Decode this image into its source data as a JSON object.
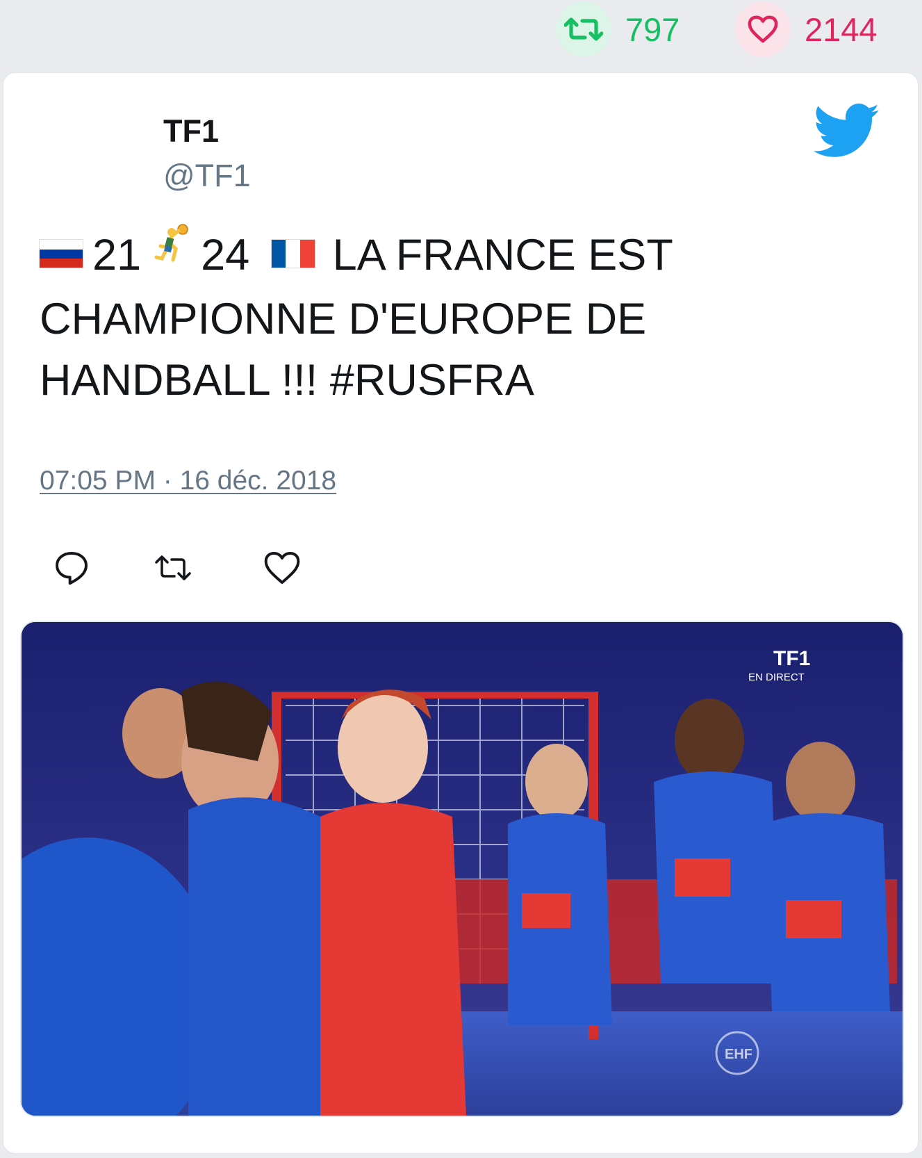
{
  "stats": {
    "retweets": "797",
    "likes": "2144",
    "retweet_color": "#17bf63",
    "like_color": "#e0245e"
  },
  "tweet": {
    "author_name": "TF1",
    "author_handle": "@TF1",
    "text_score_left": "21",
    "text_score_right": "24",
    "text_line1": "LA FRANCE EST",
    "text_line2": "CHAMPIONNE D'EUROPE DE",
    "text_line3": "HANDBALL !!! #RUSFRA",
    "timestamp": "07:05 PM · 16 déc. 2018",
    "icons": {
      "flag_left": "russia-flag-icon",
      "emoji": "handball-player-icon",
      "flag_right": "france-flag-icon",
      "brand": "twitter-bird-icon"
    },
    "actions": [
      "reply-icon",
      "retweet-icon",
      "like-icon"
    ],
    "media": {
      "watermark_logo": "TF1",
      "watermark_text": "EN DIRECT",
      "corner_logo": "EHF",
      "brand_color": "#1da1f2"
    }
  }
}
